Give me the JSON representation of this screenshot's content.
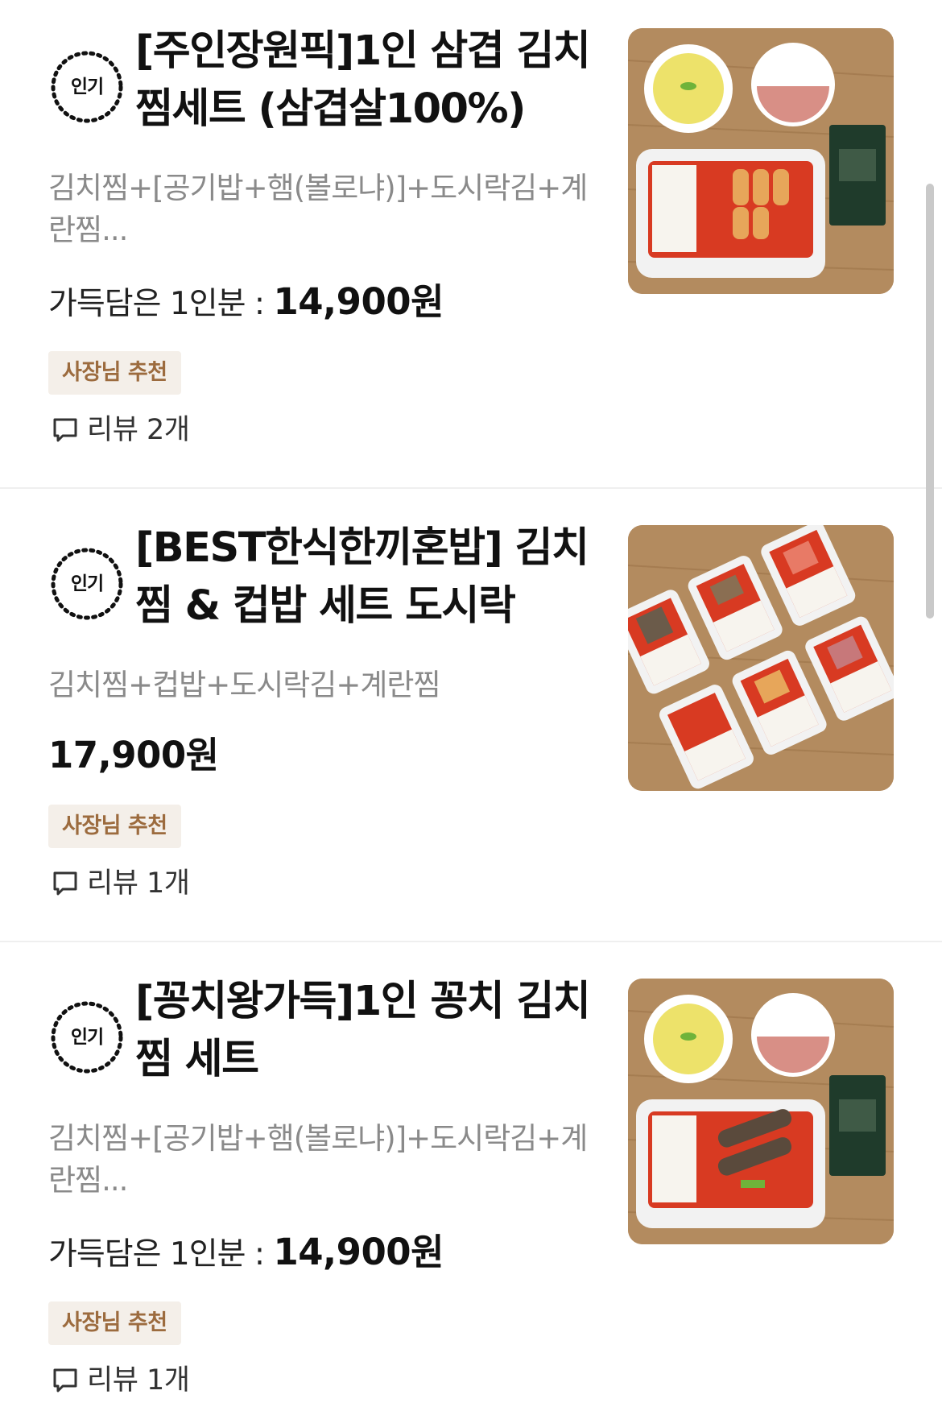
{
  "menu_items": [
    {
      "badge": "인기",
      "title": "[주인장원픽]1인 삼겹 김치찜세트 (삼겹살100%)",
      "description": "김치찜+[공기밥+햄(볼로냐)]+도시락김+계란찜...",
      "price_prefix": "가득담은 1인분 : ",
      "price": "14,900원",
      "tag": "사장님 추천",
      "review": "리뷰 2개"
    },
    {
      "badge": "인기",
      "title": "[BEST한식한끼혼밥] 김치찜 & 컵밥 세트 도시락",
      "description": "김치찜+컵밥+도시락김+계란찜",
      "price_prefix": "",
      "price": "17,900원",
      "tag": "사장님 추천",
      "review": "리뷰 1개"
    },
    {
      "badge": "인기",
      "title": "[꽁치왕가득]1인 꽁치 김치찜 세트",
      "description": "김치찜+[공기밥+햄(볼로냐)]+도시락김+계란찜...",
      "price_prefix": "가득담은 1인분 : ",
      "price": "14,900원",
      "tag": "사장님 추천",
      "review": "리뷰 1개"
    }
  ],
  "colors": {
    "tag_bg": "#f4efe9",
    "tag_text": "#9c6b3e",
    "description": "#8a8a8a",
    "divider": "#efefef"
  },
  "icons": [
    "popular-badge-icon",
    "review-speech-bubble-icon"
  ]
}
